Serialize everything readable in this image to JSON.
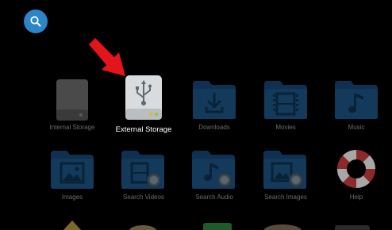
{
  "row1": [
    {
      "label": "Internal Storage",
      "icon": "hard-drive-icon"
    },
    {
      "label": "External Storage",
      "icon": "usb-drive-icon",
      "selected": true
    },
    {
      "label": "Downloads",
      "icon": "download-folder-icon"
    },
    {
      "label": "Movies",
      "icon": "film-folder-icon"
    },
    {
      "label": "Music",
      "icon": "music-folder-icon"
    }
  ],
  "row2": [
    {
      "label": "Images",
      "icon": "image-folder-icon"
    },
    {
      "label": "Search Videos",
      "icon": "search-video-folder-icon"
    },
    {
      "label": "Search Audio",
      "icon": "search-audio-folder-icon"
    },
    {
      "label": "Search Images",
      "icon": "search-image-folder-icon"
    },
    {
      "label": "Help",
      "icon": "lifebuoy-icon"
    }
  ],
  "colors": {
    "folder": "#133a5b",
    "folder_tab": "#0f3050",
    "folder_symbol": "#0a2136",
    "accent_blue": "#2a86c9",
    "arrow_red": "#e3141a",
    "label_dim": "#6b6b6b",
    "label_selected": "#ffffff"
  }
}
